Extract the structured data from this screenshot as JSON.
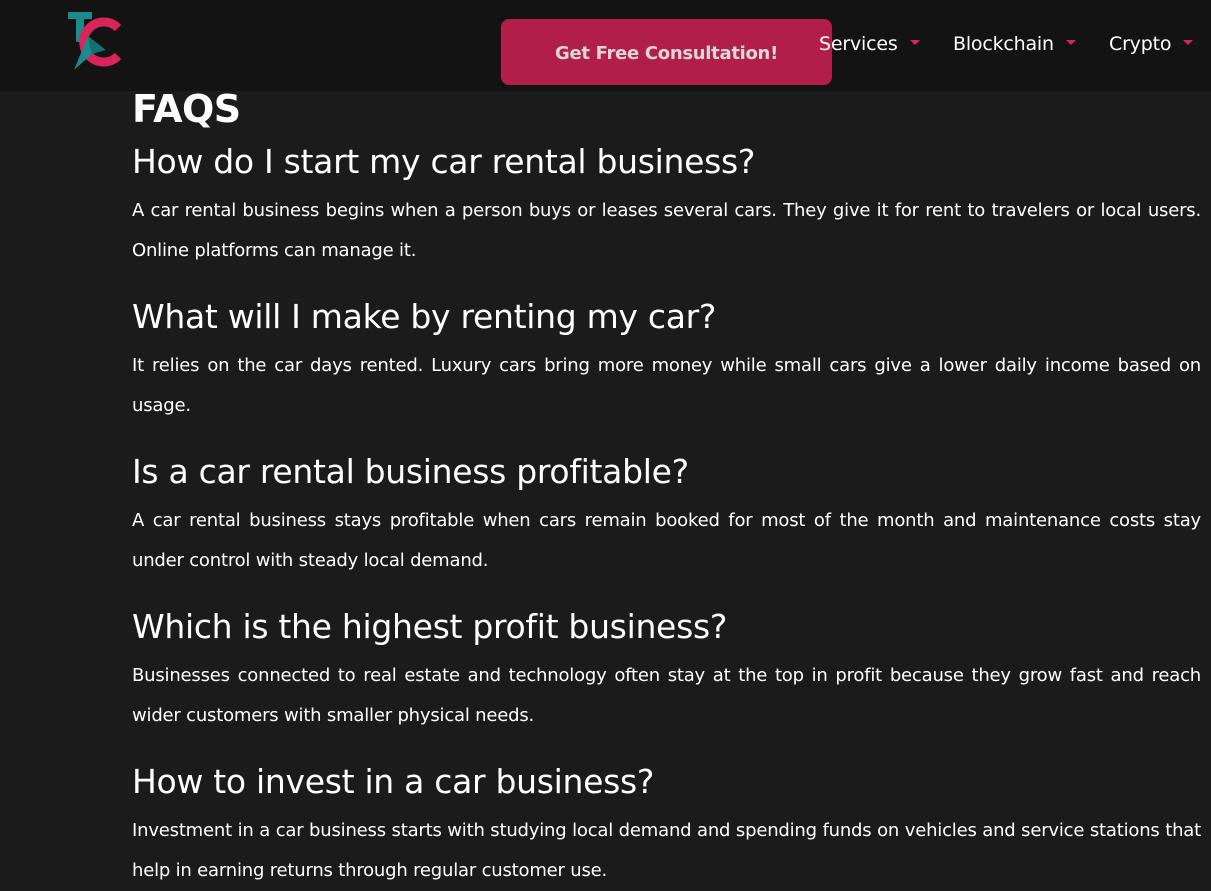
{
  "header": {
    "logo_alt": "TC logo",
    "cta_label": "Get Free Consultation!",
    "nav": [
      {
        "label": "Services"
      },
      {
        "label": "Blockchain"
      },
      {
        "label": "Crypto"
      }
    ]
  },
  "faq": {
    "title": "FAQS",
    "items": [
      {
        "question": "How do I start my car rental business?",
        "answer": "A car rental business begins when a person buys or leases several cars. They give it for rent to travelers or local users. Online platforms can manage it."
      },
      {
        "question": "What will I make by renting my car?",
        "answer": "It relies on the car days rented. Luxury cars bring more money while small cars give a lower daily income based on usage."
      },
      {
        "question": "Is a car rental business profitable?",
        "answer": "A car rental business stays profitable when cars remain booked for most of the month and maintenance costs stay under control with steady local demand."
      },
      {
        "question": "Which is the highest profit business?",
        "answer": "Businesses connected to real estate and technology often stay at the top in profit because they grow fast and reach wider customers with smaller physical needs."
      },
      {
        "question": "How to invest in a car business?",
        "answer": "Investment in a car business starts with studying local demand and spending funds on vehicles and service stations that help in earning returns through regular customer use."
      }
    ]
  },
  "colors": {
    "page_bg": "#1b1b1b",
    "header_bg": "#131313",
    "accent": "#b21e4a",
    "caret": "#d8245a",
    "logo_teal": "#1a8a8a",
    "logo_pink": "#d8245a"
  }
}
